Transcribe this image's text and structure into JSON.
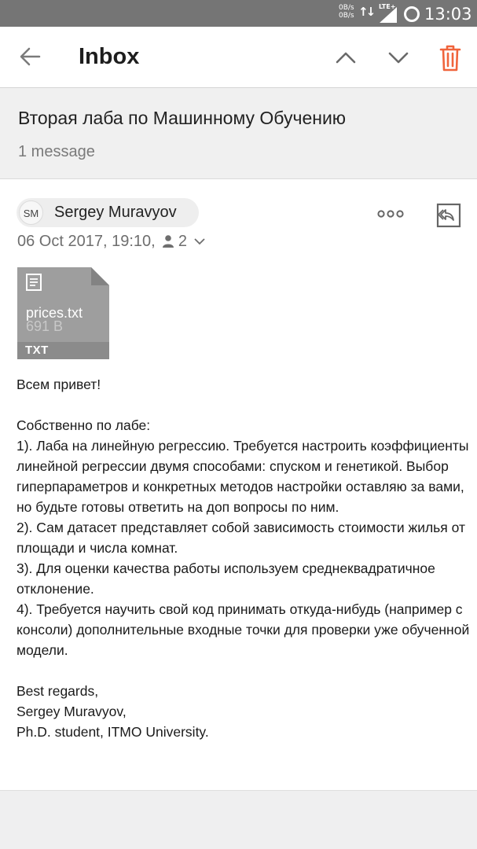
{
  "status_bar": {
    "net_speed_up": "0B/s",
    "net_speed_down": "0B/s",
    "network": "LTE+",
    "time": "13:03"
  },
  "toolbar": {
    "title": "Inbox",
    "back_icon": "arrow-left-icon",
    "prev_icon": "chevron-up-icon",
    "next_icon": "chevron-down-icon",
    "delete_icon": "trash-icon",
    "accent_color": "#f0643c"
  },
  "thread": {
    "subject": "Вторая лаба по Машинному Обучению",
    "message_count": "1 message"
  },
  "message": {
    "sender_initials": "SM",
    "sender_name": "Sergey Muravyov",
    "date": "06 Oct 2017, 19:10,",
    "recipients_count": "2",
    "attachment": {
      "filename": "prices.txt",
      "size": "691 B",
      "type": "TXT"
    },
    "body": {
      "greeting": "Всем привет!",
      "intro": "Собственно по лабе:",
      "items": [
        "1). Лаба на линейную регрессию. Требуется настроить коэффициенты линейной регрессии двумя способами: спуском и генетикой. Выбор гиперпараметров и конкретных методов настройки оставляю за вами, но будьте готовы ответить на доп вопросы по ним.",
        "2). Сам датасет представляет собой зависимость стоимости жилья от площади и числа комнат.",
        "3). Для оценки качества работы используем среднеквадратичное отклонение.",
        "4). Требуется научить свой код принимать откуда-нибудь (например с консоли) дополнительные входные точки для проверки уже обученной модели."
      ],
      "signature": [
        "Best regards,",
        "Sergey Muravyov,",
        "Ph.D. student, ITMO University."
      ]
    }
  }
}
